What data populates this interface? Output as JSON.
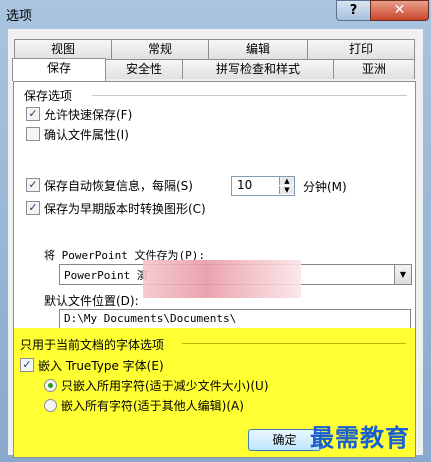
{
  "window": {
    "title": "选项",
    "help_label": "?",
    "close_label": "✕"
  },
  "tabs": {
    "row_back": [
      "视图",
      "常规",
      "编辑",
      "打印"
    ],
    "row_front": [
      "保存",
      "安全性",
      "拼写检查和样式",
      "亚洲"
    ]
  },
  "save_options": {
    "group_label": "保存选项",
    "allow_fast_save": "允许快速保存(F)",
    "confirm_file_props": "确认文件属性(I)",
    "autorecover_label": "保存自动恢复信息，每隔(S)",
    "autorecover_value": "10",
    "minutes_label": "分钟(M)",
    "save_as_old_format": "保存为早期版本时转换图形(C)",
    "save_as_label": "将 PowerPoint 文件存为(P):",
    "save_as_value": "PowerPoint 演",
    "default_location_label": "默认文件位置(D):",
    "default_location_value": "D:\\My Documents\\Documents\\"
  },
  "font_options": {
    "group_label": "只用于当前文档的字体选项",
    "embed_truetype": "嵌入 TrueType 字体(E)",
    "embed_used_only": "只嵌入所用字符(适于减少文件大小)(U)",
    "embed_all": "嵌入所有字符(适于其他人编辑)(A)"
  },
  "buttons": {
    "ok": "确定"
  },
  "watermark": "最需教育"
}
